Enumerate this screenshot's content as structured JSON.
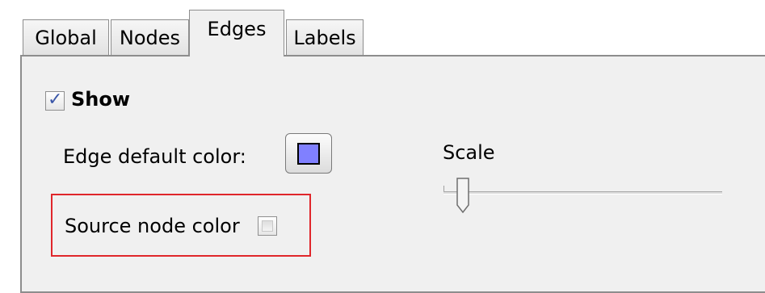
{
  "tabs": [
    {
      "label": "Global",
      "active": false
    },
    {
      "label": "Nodes",
      "active": false
    },
    {
      "label": "Edges",
      "active": true
    },
    {
      "label": "Labels",
      "active": false
    }
  ],
  "show": {
    "label": "Show",
    "checked": true
  },
  "edge_color": {
    "label": "Edge default color:",
    "color": "#8080ff"
  },
  "source_node_color": {
    "label": "Source node color",
    "checked": false
  },
  "scale": {
    "label": "Scale",
    "value_fraction": 0.05
  },
  "colors": {
    "highlight": "#e0262b",
    "check_mark": "#3b57a8"
  }
}
